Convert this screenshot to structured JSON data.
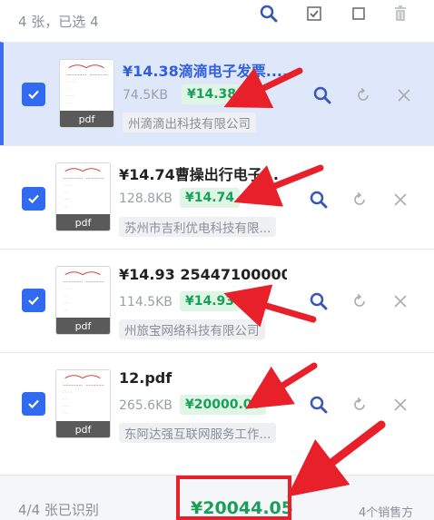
{
  "header": {
    "title": "4 张，已选 4",
    "tools": {
      "search_icon": "magnifier",
      "checkall_icon": "checkbox-checked",
      "uncheck_icon": "checkbox-empty",
      "trash_icon": "trash"
    }
  },
  "items": [
    {
      "title": "¥14.38滴滴电子发票....",
      "size": "74.5KB",
      "amount": "¥14.38",
      "seller": "州滴滴出科技有限公司",
      "thumb_label": "pdf",
      "selected": true
    },
    {
      "title": "¥14.74曹操出行电子...",
      "size": "128.8KB",
      "amount": "¥14.74",
      "seller": "苏州市吉利优电科技有限...",
      "thumb_label": "pdf",
      "selected": true
    },
    {
      "title": "¥14.93 25447100000...",
      "size": "114.5KB",
      "amount": "¥14.93",
      "seller": "州旅宝网络科技有限公司",
      "thumb_label": "pdf",
      "selected": true
    },
    {
      "title": "12.pdf",
      "size": "265.6KB",
      "amount": "¥20000.00",
      "seller": "东阿达强互联网服务工作...",
      "thumb_label": "pdf",
      "selected": true
    }
  ],
  "footer": {
    "status": "4/4 张已识别",
    "total": "¥20044.05",
    "sellers": "4个销售方"
  },
  "colors": {
    "accent": "#2f6af0",
    "amount_green": "#18a058",
    "amount_bg": "#dff6e6",
    "annotation_red": "#e8202a"
  }
}
